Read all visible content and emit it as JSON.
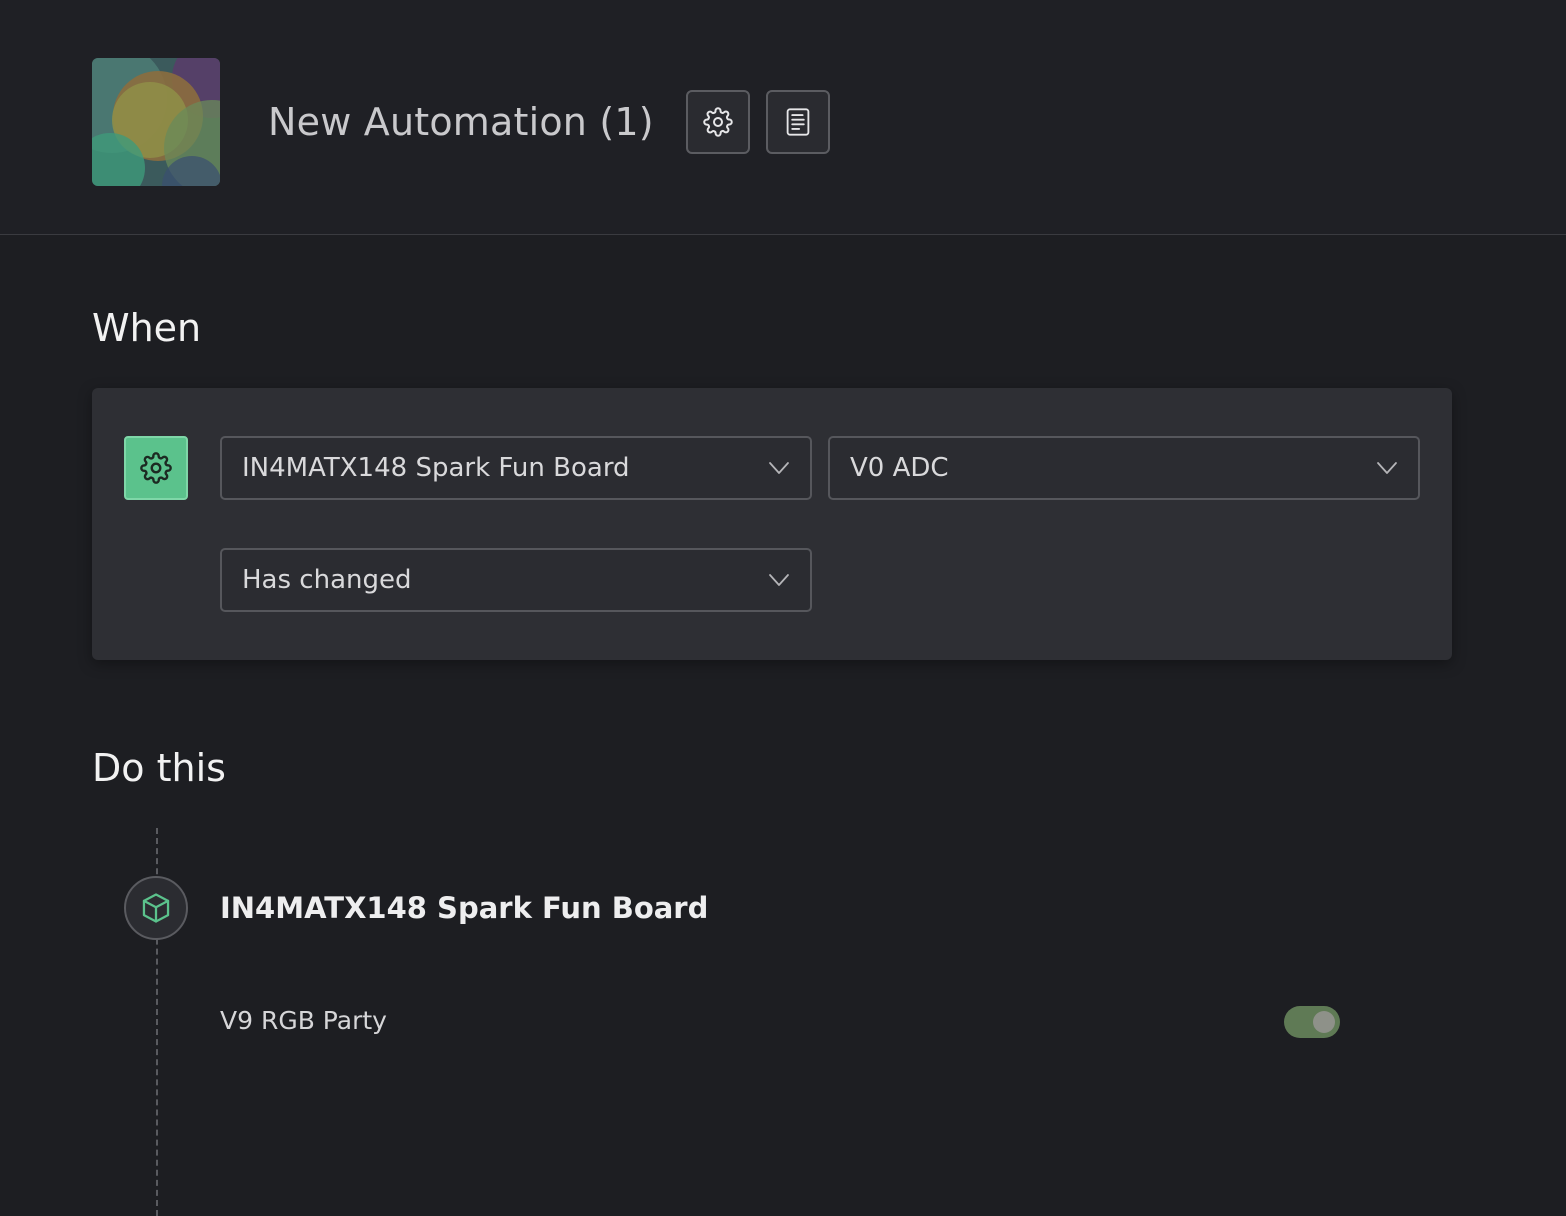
{
  "header": {
    "title": "New Automation (1)",
    "thumbnail_icon": "automation-thumbnail",
    "settings_icon": "gear-icon",
    "log_icon": "document-icon"
  },
  "when": {
    "title": "When",
    "trigger_icon": "gear-icon",
    "accent_color": "#5bc28c",
    "device_select": {
      "value": "IN4MATX148 Spark Fun Board"
    },
    "datastream_select": {
      "value": "V0 ADC"
    },
    "condition_select": {
      "value": "Has changed"
    }
  },
  "do_this": {
    "title": "Do this",
    "action": {
      "icon": "cube-icon",
      "device": "IN4MATX148 Spark Fun Board",
      "datastream": "V9 RGB Party",
      "toggle_on": true
    }
  }
}
